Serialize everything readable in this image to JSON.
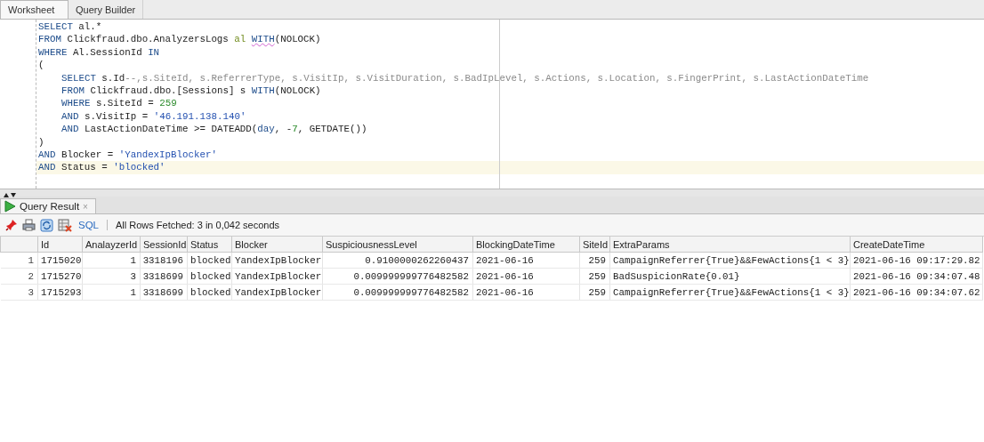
{
  "tabs": [
    {
      "label": "Worksheet",
      "selected": true
    },
    {
      "label": "Query Builder",
      "selected": false
    }
  ],
  "editor": {
    "lines": [
      {
        "current": false,
        "indented": false,
        "tokens": [
          {
            "kind": "keyword",
            "text": "SELECT",
            "squiggle": false
          },
          {
            "kind": "plain",
            "text": " al.*",
            "squiggle": false
          }
        ]
      },
      {
        "current": false,
        "indented": false,
        "tokens": [
          {
            "kind": "keyword",
            "text": "FROM",
            "squiggle": false
          },
          {
            "kind": "plain",
            "text": " Clickfraud.dbo.AnalyzersLogs ",
            "squiggle": false
          },
          {
            "kind": "alias",
            "text": "al ",
            "squiggle": false
          },
          {
            "kind": "keyword",
            "text": "WITH",
            "squiggle": true
          },
          {
            "kind": "plain",
            "text": "(NOLOCK)",
            "squiggle": false
          }
        ]
      },
      {
        "current": false,
        "indented": false,
        "tokens": [
          {
            "kind": "keyword",
            "text": "WHERE",
            "squiggle": false
          },
          {
            "kind": "plain",
            "text": " Al.SessionId ",
            "squiggle": false
          },
          {
            "kind": "keyword",
            "text": "IN",
            "squiggle": false
          }
        ]
      },
      {
        "current": false,
        "indented": false,
        "tokens": [
          {
            "kind": "plain",
            "text": "(",
            "squiggle": false
          }
        ]
      },
      {
        "current": false,
        "indented": true,
        "tokens": [
          {
            "kind": "keyword",
            "text": "SELECT",
            "squiggle": false
          },
          {
            "kind": "plain",
            "text": " s.Id",
            "squiggle": false
          },
          {
            "kind": "comment",
            "text": "--,s.SiteId, s.ReferrerType, s.VisitIp, s.VisitDuration, s.BadIpLevel, s.Actions, s.Location, s.FingerPrint, s.LastActionDateTime",
            "squiggle": false
          }
        ]
      },
      {
        "current": false,
        "indented": true,
        "tokens": [
          {
            "kind": "keyword",
            "text": "FROM",
            "squiggle": false
          },
          {
            "kind": "plain",
            "text": " Clickfraud.dbo.[Sessions] s ",
            "squiggle": false
          },
          {
            "kind": "keyword",
            "text": "WITH",
            "squiggle": false
          },
          {
            "kind": "plain",
            "text": "(NOLOCK)",
            "squiggle": false
          }
        ]
      },
      {
        "current": false,
        "indented": true,
        "tokens": [
          {
            "kind": "keyword",
            "text": "WHERE",
            "squiggle": false
          },
          {
            "kind": "plain",
            "text": " s.SiteId = ",
            "squiggle": false
          },
          {
            "kind": "number",
            "text": "259",
            "squiggle": false
          }
        ]
      },
      {
        "current": false,
        "indented": true,
        "tokens": [
          {
            "kind": "keyword",
            "text": "AND",
            "squiggle": false
          },
          {
            "kind": "plain",
            "text": " s.VisitIp = ",
            "squiggle": false
          },
          {
            "kind": "string",
            "text": "'46.191.138.140'",
            "squiggle": false
          }
        ]
      },
      {
        "current": false,
        "indented": true,
        "tokens": [
          {
            "kind": "keyword",
            "text": "AND",
            "squiggle": false
          },
          {
            "kind": "plain",
            "text": " LastActionDateTime >= DATEADD(",
            "squiggle": false
          },
          {
            "kind": "keyword",
            "text": "day",
            "squiggle": false
          },
          {
            "kind": "plain",
            "text": ", -",
            "squiggle": false
          },
          {
            "kind": "number",
            "text": "7",
            "squiggle": false
          },
          {
            "kind": "plain",
            "text": ", GETDATE())",
            "squiggle": false
          }
        ]
      },
      {
        "current": false,
        "indented": false,
        "tokens": [
          {
            "kind": "plain",
            "text": ")",
            "squiggle": false
          }
        ]
      },
      {
        "current": false,
        "indented": false,
        "tokens": [
          {
            "kind": "keyword",
            "text": "AND",
            "squiggle": false
          },
          {
            "kind": "plain",
            "text": " Blocker = ",
            "squiggle": false
          },
          {
            "kind": "string",
            "text": "'YandexIpBlocker'",
            "squiggle": false
          }
        ]
      },
      {
        "current": true,
        "indented": false,
        "tokens": [
          {
            "kind": "keyword",
            "text": "AND",
            "squiggle": false
          },
          {
            "kind": "plain",
            "text": " Status = ",
            "squiggle": false
          },
          {
            "kind": "string",
            "text": "'blocked'",
            "squiggle": false
          }
        ]
      }
    ]
  },
  "result_panel": {
    "tab": {
      "label": "Query Result",
      "close": "×"
    },
    "toolbar": {
      "sql_link": "SQL",
      "status": "All Rows Fetched: 3 in 0,042 seconds"
    },
    "table": {
      "columns": [
        {
          "label": "Id",
          "numeric": false
        },
        {
          "label": "AnalayzerId",
          "numeric": true
        },
        {
          "label": "SessionId",
          "numeric": true
        },
        {
          "label": "Status",
          "numeric": false
        },
        {
          "label": "Blocker",
          "numeric": false
        },
        {
          "label": "SuspiciousnessLevel",
          "numeric": true
        },
        {
          "label": "BlockingDateTime",
          "numeric": false
        },
        {
          "label": "SiteId",
          "numeric": true
        },
        {
          "label": "ExtraParams",
          "numeric": false
        },
        {
          "label": "CreateDateTime",
          "numeric": false
        }
      ],
      "rows": [
        {
          "row_number": "1",
          "cells": [
            "1715020",
            "1",
            "3318196",
            "blocked",
            "YandexIpBlocker",
            "0.9100000262260437",
            "2021-06-16",
            "259",
            "CampaignReferrer{True}&&FewActions{1 < 3}",
            "2021-06-16 09:17:29.82"
          ]
        },
        {
          "row_number": "2",
          "cells": [
            "1715270",
            "3",
            "3318699",
            "blocked",
            "YandexIpBlocker",
            "0.009999999776482582",
            "2021-06-16",
            "259",
            "BadSuspicionRate{0.01}",
            "2021-06-16 09:34:07.48"
          ]
        },
        {
          "row_number": "3",
          "cells": [
            "1715293",
            "1",
            "3318699",
            "blocked",
            "YandexIpBlocker",
            "0.009999999776482582",
            "2021-06-16",
            "259",
            "CampaignReferrer{True}&&FewActions{1 < 3}",
            "2021-06-16 09:34:07.62"
          ]
        }
      ]
    }
  }
}
